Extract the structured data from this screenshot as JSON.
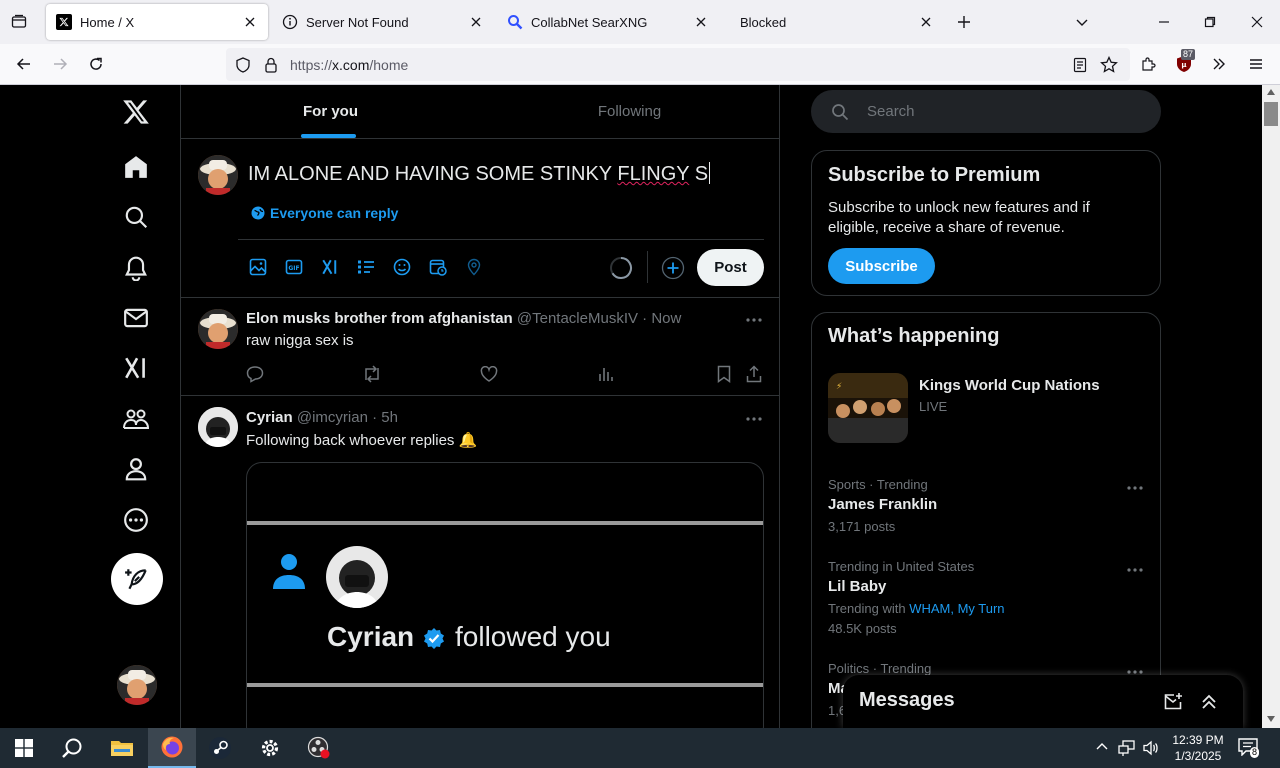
{
  "browser": {
    "tabs": [
      {
        "title": "Home / X",
        "active": true
      },
      {
        "title": "Server Not Found",
        "active": false
      },
      {
        "title": "CollabNet SearXNG",
        "active": false
      },
      {
        "title": "Blocked",
        "active": false
      }
    ],
    "url_prefix": "https://",
    "url_domain": "x.com",
    "url_path": "/home",
    "extension_badge": "87"
  },
  "timeline": {
    "tabs": [
      "For you",
      "Following"
    ],
    "composer": {
      "text_before": "IM ALONE AND HAVING SOME STINKY ",
      "text_misspelled": "FLINGY",
      "text_after": " S",
      "reply_setting": "Everyone can reply",
      "post_label": "Post"
    },
    "tweets": [
      {
        "name": "Elon musks brother from afghanistan",
        "handle": "@TentacleMuskIV",
        "time": "· Now",
        "text": "raw nigga sex is"
      },
      {
        "name": "Cyrian",
        "handle": "@imcyrian",
        "time": "· 5h",
        "text": "Following back whoever replies 🔔",
        "media_name": "Cyrian",
        "media_text": "followed you"
      }
    ]
  },
  "right": {
    "search_placeholder": "Search",
    "premium": {
      "title": "Subscribe to Premium",
      "desc": "Subscribe to unlock new features and if eligible, receive a share of revenue.",
      "button": "Subscribe"
    },
    "happening": {
      "title": "What’s happening",
      "live": {
        "name": "Kings World Cup Nations",
        "status": "LIVE"
      },
      "trends": [
        {
          "meta": "Sports · Trending",
          "name": "James Franklin",
          "posts": "3,171 posts"
        },
        {
          "meta": "Trending in United States",
          "name": "Lil Baby",
          "with_label": "Trending with",
          "with_links": "WHAM, My Turn",
          "posts": "48.5K posts"
        },
        {
          "meta": "Politics · Trending",
          "name": "Ma",
          "posts": "1,6"
        }
      ]
    },
    "messages_title": "Messages"
  },
  "taskbar": {
    "time": "12:39 PM",
    "date": "1/3/2025",
    "notifications": "8"
  },
  "colors": {
    "accent": "#1d9bf0",
    "background": "#000000",
    "text": "#e7e9ea",
    "muted": "#71767b",
    "border": "#2f3336"
  }
}
